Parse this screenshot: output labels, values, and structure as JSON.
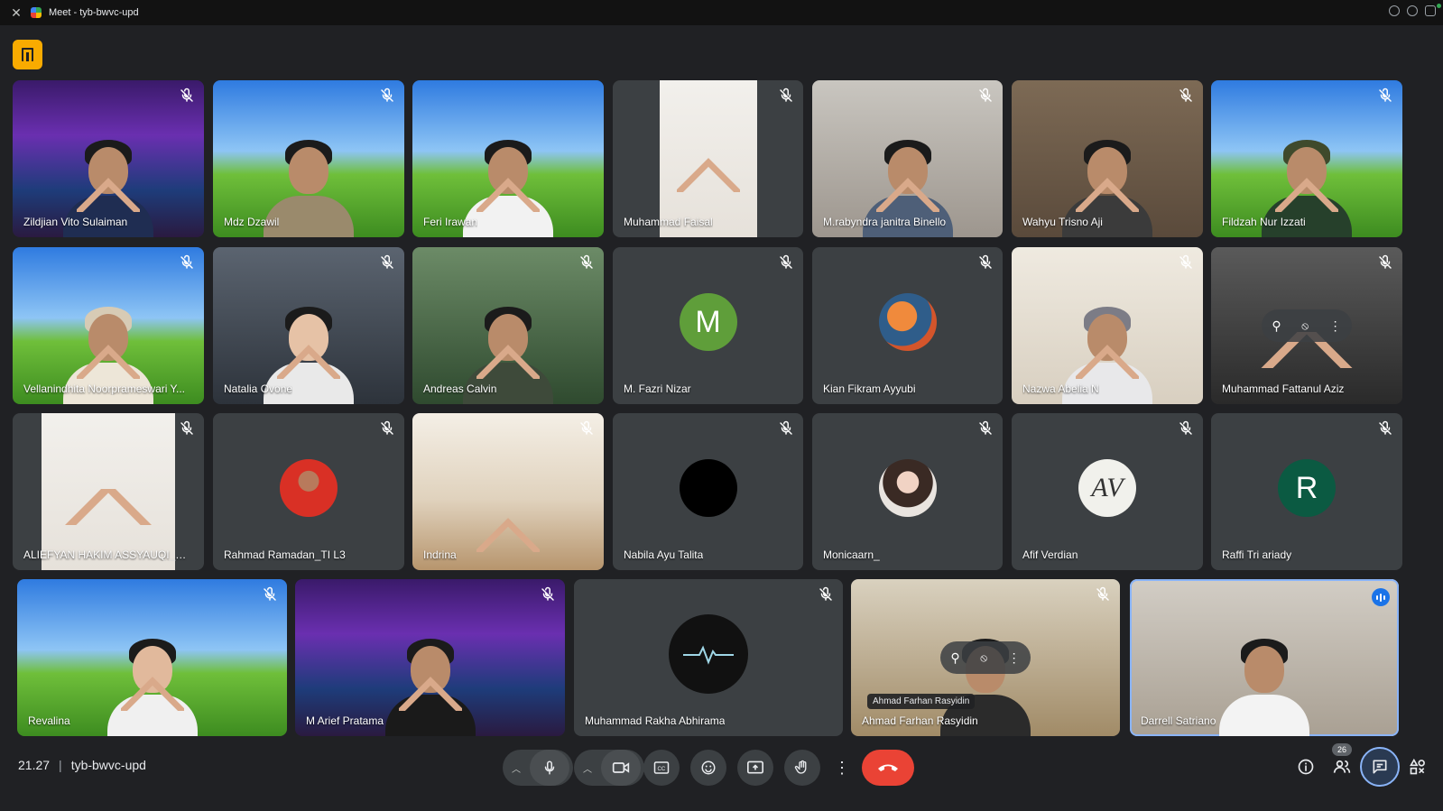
{
  "window": {
    "title": "Meet - tyb-bwvc-upd"
  },
  "colors": {
    "accent": "#8ab4f8",
    "end_call": "#ea4335",
    "app_badge": "#f9ab00",
    "tile_bg": "#3c4043",
    "page_bg": "#202124"
  },
  "grid_row1": [
    {
      "name": "Zildjian Vito Sulaiman",
      "muted": true
    },
    {
      "name": "Mdz Dzawil",
      "muted": true
    },
    {
      "name": "Feri Irawan",
      "muted": false
    },
    {
      "name": "Muhammad Faisal",
      "muted": true
    },
    {
      "name": "M.rabyndra janitra Binello",
      "muted": true
    },
    {
      "name": "Wahyu Trisno Aji",
      "muted": true
    },
    {
      "name": "Fildzah Nur Izzati",
      "muted": true
    }
  ],
  "grid_row2": [
    {
      "name": "Vellanindhita Noorprameswari Y...",
      "muted": true
    },
    {
      "name": "Natalia Ovone",
      "muted": true
    },
    {
      "name": "Andreas Calvin",
      "muted": true
    },
    {
      "name": "M. Fazri Nizar",
      "muted": true,
      "avatar_letter": "M",
      "avatar_color": "#5f9e3a"
    },
    {
      "name": "Kian Fikram Ayyubi",
      "muted": true
    },
    {
      "name": "Nazwa Abelia N",
      "muted": true
    },
    {
      "name": "Muhammad Fattanul Aziz",
      "muted": true
    }
  ],
  "grid_row3": [
    {
      "name": "ALIEFYAN HAKIM ASSYAUQI_FA...",
      "muted": true
    },
    {
      "name": "Rahmad Ramadan_TI L3",
      "muted": true
    },
    {
      "name": "Indrina",
      "muted": true
    },
    {
      "name": "Nabila Ayu Talita",
      "muted": true
    },
    {
      "name": "Monicaarn_",
      "muted": true
    },
    {
      "name": "Afif Verdian",
      "muted": true
    },
    {
      "name": "Raffi Tri ariady",
      "muted": true,
      "avatar_letter": "R",
      "avatar_color": "#0b5a42"
    }
  ],
  "grid_row4": [
    {
      "name": "Revalina",
      "muted": true
    },
    {
      "name": "M Arief Pratama",
      "muted": true
    },
    {
      "name": "Muhammad Rakha Abhirama",
      "muted": true
    },
    {
      "name": "Ahmad Farhan Rasyidin",
      "muted": true,
      "tooltip": "Ahmad Farhan Rasyidin"
    },
    {
      "name": "Darrell Satriano",
      "muted": false,
      "speaking": true
    }
  ],
  "bottombar": {
    "time": "21.27",
    "meeting_code": "tyb-bwvc-upd",
    "participants_count": "26"
  }
}
